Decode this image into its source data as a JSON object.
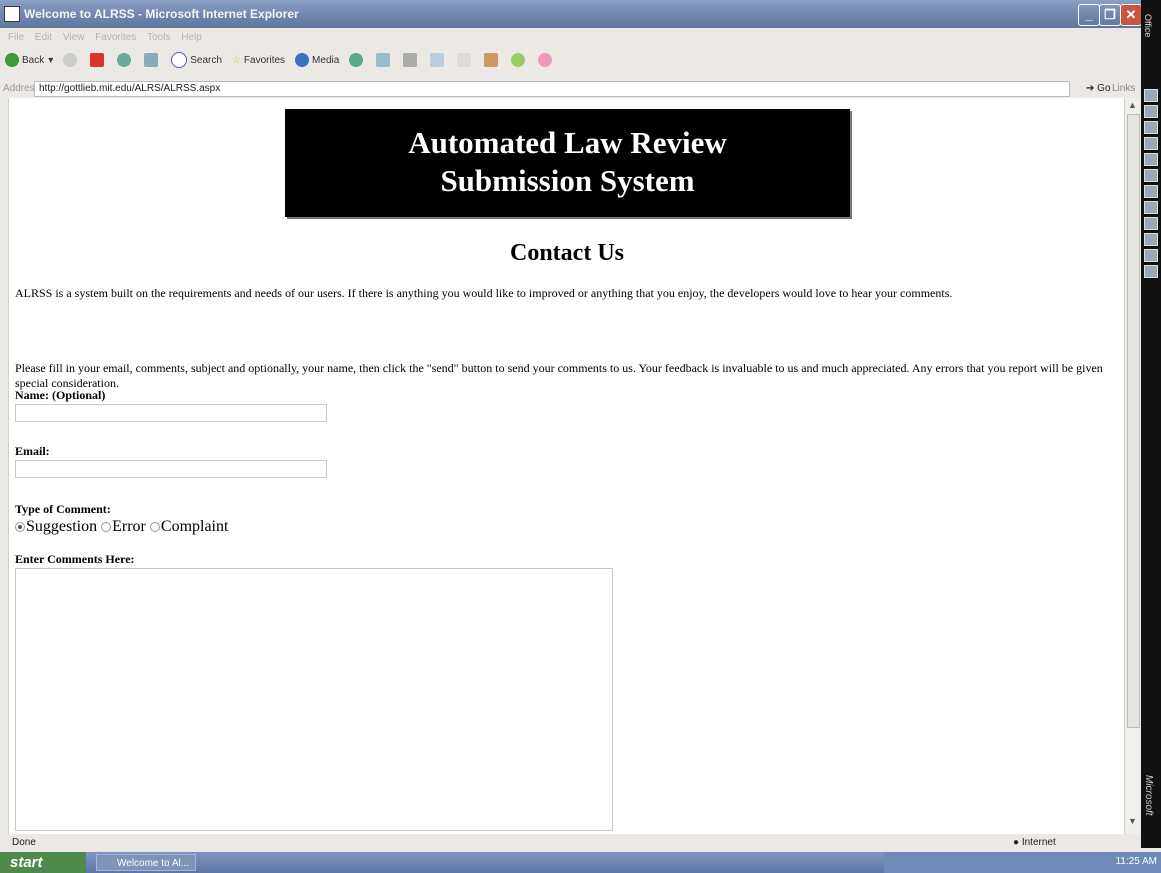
{
  "window": {
    "title": "Welcome to ALRSS - Microsoft Internet Explorer"
  },
  "menu": [
    "File",
    "Edit",
    "View",
    "Favorites",
    "Tools",
    "Help"
  ],
  "toolbar": {
    "back": "Back",
    "search": "Search",
    "favorites": "Favorites",
    "media": "Media"
  },
  "address": {
    "label": "Address",
    "url": "http://gottlieb.mit.edu/ALRS/ALRSS.aspx",
    "go": "Go",
    "links": "Links"
  },
  "page": {
    "header_line1": "Automated Law Review",
    "header_line2": "Submission System",
    "heading": "Contact Us",
    "intro": "ALRSS is a system built on the requirements and needs of our users. If there is anything you would like to improved or anything that you enjoy, the developers would love to hear your comments.",
    "instructions": "Please fill in your email, comments, subject and optionally, your name, then click the \"send\" button to send your comments to us. Your feedback is invaluable to us and much appreciated. Any errors that you report will be given special consideration.",
    "name_label": "Name: (Optional)",
    "email_label": "Email:",
    "comment_type_label": "Type of Comment:",
    "options": [
      "Suggestion",
      "Error",
      "Complaint"
    ],
    "selected_option": "Suggestion",
    "comments_label": "Enter Comments Here:"
  },
  "status": {
    "left": "Done",
    "zone": "Internet"
  },
  "taskbar": {
    "start": "start",
    "task": "Welcome to Al...",
    "time": "11:25 AM"
  },
  "side": {
    "top": "Office",
    "bottom": "Microsoft"
  }
}
